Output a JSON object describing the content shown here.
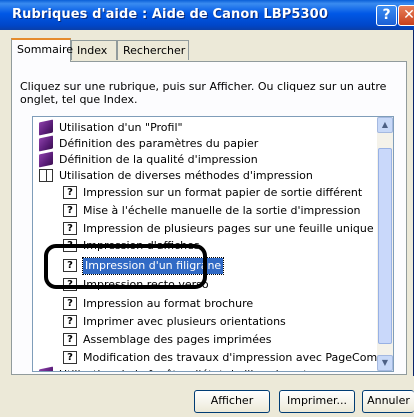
{
  "window": {
    "title": "Rubriques d'aide : Aide de Canon LBP5300",
    "help_symbol": "?",
    "close_symbol": "✕"
  },
  "tabs": [
    {
      "label": "Sommaire"
    },
    {
      "label": "Index"
    },
    {
      "label": "Rechercher"
    }
  ],
  "instructions": "Cliquez sur une rubrique, puis sur Afficher. Ou cliquez sur un autre onglet, tel que Index.",
  "tree": {
    "items": [
      {
        "label": "Utilisation d'un \"Profil\"",
        "icon": "closed-book-icon"
      },
      {
        "label": "Définition des paramètres du papier",
        "icon": "closed-book-icon"
      },
      {
        "label": "Définition de la qualité d'impression",
        "icon": "closed-book-icon"
      },
      {
        "label": "Utilisation de diverses méthodes d'impression",
        "icon": "open-book-icon"
      },
      {
        "label": "Impression sur un format papier de sortie différent",
        "icon": "help-topic-icon"
      },
      {
        "label": "Mise à l'échelle manuelle de la sortie d'impression",
        "icon": "help-topic-icon"
      },
      {
        "label": "Impression de plusieurs pages sur une feuille unique",
        "icon": "help-topic-icon"
      },
      {
        "label": "Impression d'affiches",
        "icon": "help-topic-icon"
      },
      {
        "label": "Impression d'un filigrane",
        "icon": "help-topic-icon",
        "selected": true
      },
      {
        "label": "Impression recto verso",
        "icon": "help-topic-icon"
      },
      {
        "label": "Impression au format brochure",
        "icon": "help-topic-icon"
      },
      {
        "label": "Imprimer avec plusieurs orientations",
        "icon": "help-topic-icon"
      },
      {
        "label": "Assemblage des pages imprimées",
        "icon": "help-topic-icon"
      },
      {
        "label": "Modification des travaux d'impression avec PageComposer",
        "icon": "help-topic-icon"
      },
      {
        "label": "Utilisation de la fenêtre d'état de l'imprimante",
        "icon": "closed-book-icon"
      }
    ]
  },
  "buttons": {
    "afficher": "Afficher",
    "imprimer": "Imprimer...",
    "annuler": "Annuler"
  },
  "colors": {
    "titlebar": "#0058e6",
    "selection": "#316ac5",
    "tab_accent": "#e68b2c"
  }
}
